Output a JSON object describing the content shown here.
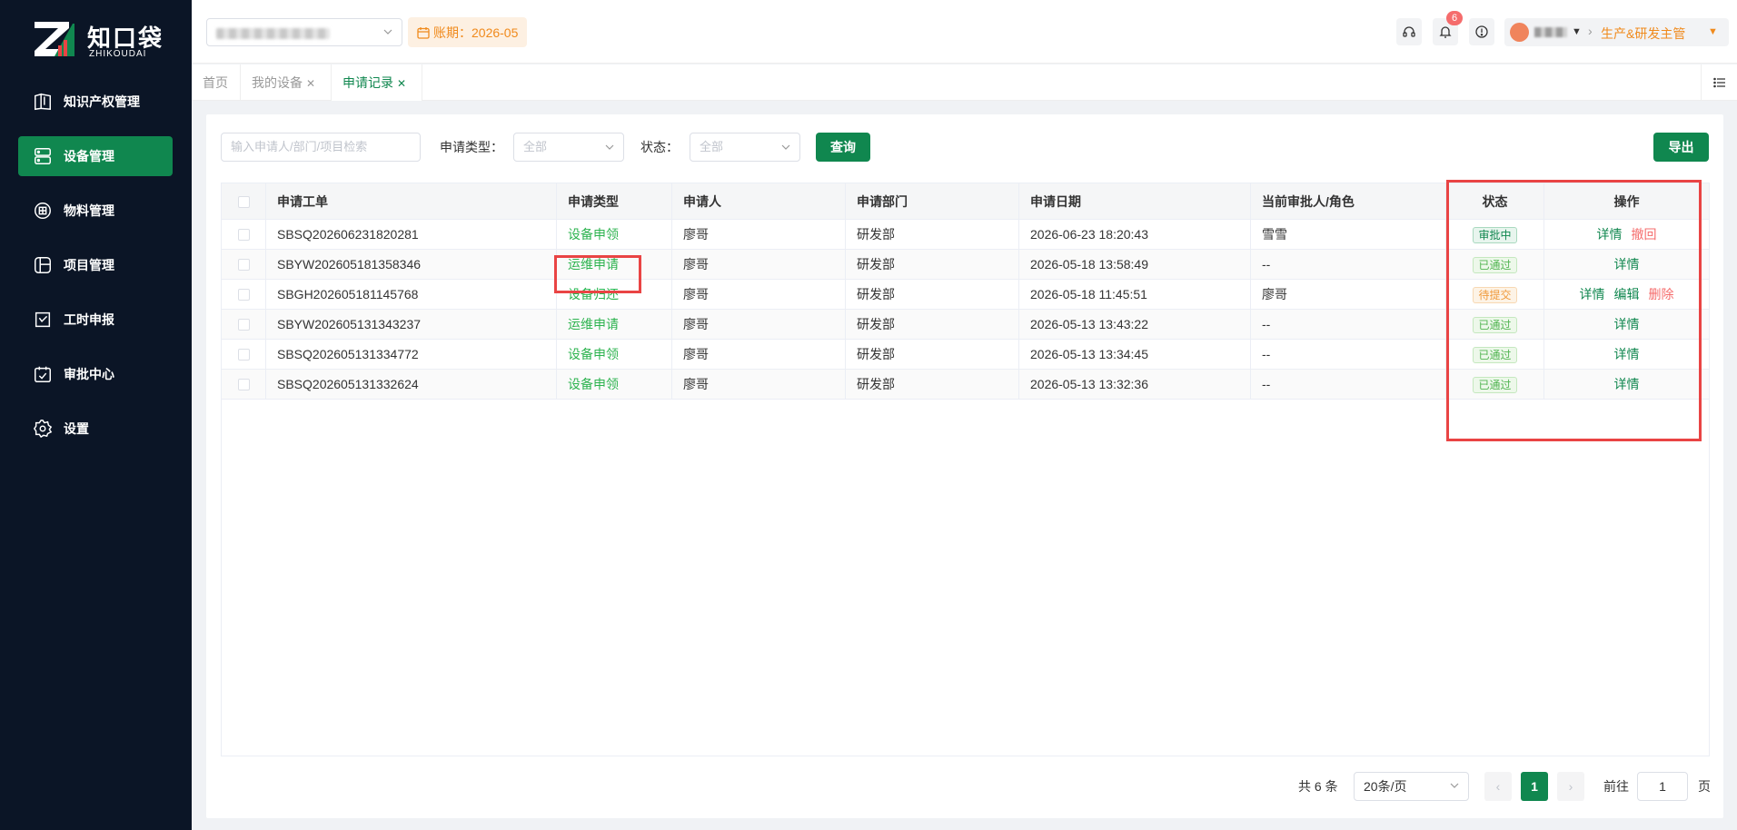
{
  "brand": {
    "name_cn": "知口袋",
    "name_en": "ZHIKOUDAI"
  },
  "sidebar": {
    "items": [
      {
        "label": "知识产权管理",
        "icon": "book-icon",
        "active": false
      },
      {
        "label": "设备管理",
        "icon": "server-icon",
        "active": true
      },
      {
        "label": "物料管理",
        "icon": "box-icon",
        "active": false
      },
      {
        "label": "项目管理",
        "icon": "project-icon",
        "active": false
      },
      {
        "label": "工时申报",
        "icon": "clock-icon",
        "active": false
      },
      {
        "label": "审批中心",
        "icon": "approval-icon",
        "active": false
      },
      {
        "label": "设置",
        "icon": "gear-icon",
        "active": false
      }
    ]
  },
  "header": {
    "period_label": "账期：2026-05",
    "notification_count": "6",
    "role": "生产&研发主管"
  },
  "tabs": [
    {
      "label": "首页",
      "closable": false
    },
    {
      "label": "我的设备",
      "closable": true
    },
    {
      "label": "申请记录",
      "closable": true
    }
  ],
  "filters": {
    "search_placeholder": "输入申请人/部门/项目检索",
    "type_label": "申请类型：",
    "type_value": "全部",
    "status_label": "状态：",
    "status_value": "全部",
    "query_button": "查询",
    "export_button": "导出"
  },
  "table": {
    "columns": [
      "申请工单",
      "申请类型",
      "申请人",
      "申请部门",
      "申请日期",
      "当前审批人/角色",
      "状态",
      "操作"
    ],
    "rows": [
      {
        "order": "SBSQ202606231820281",
        "type": "设备申领",
        "applicant": "廖哥",
        "dept": "研发部",
        "date": "2026-06-23 18:20:43",
        "approver": "雪雪",
        "status": "审批中",
        "status_kind": "pending",
        "ops": [
          {
            "label": "详情",
            "kind": "green"
          },
          {
            "label": "撤回",
            "kind": "red"
          }
        ]
      },
      {
        "order": "SBYW202605181358346",
        "type": "运维申请",
        "applicant": "廖哥",
        "dept": "研发部",
        "date": "2026-05-18 13:58:49",
        "approver": "--",
        "status": "已通过",
        "status_kind": "passed",
        "ops": [
          {
            "label": "详情",
            "kind": "green"
          }
        ]
      },
      {
        "order": "SBGH202605181145768",
        "type": "设备归还",
        "applicant": "廖哥",
        "dept": "研发部",
        "date": "2026-05-18 11:45:51",
        "approver": "廖哥",
        "status": "待提交",
        "status_kind": "draft",
        "ops": [
          {
            "label": "详情",
            "kind": "green"
          },
          {
            "label": "编辑",
            "kind": "green"
          },
          {
            "label": "删除",
            "kind": "red"
          }
        ]
      },
      {
        "order": "SBYW202605131343237",
        "type": "运维申请",
        "applicant": "廖哥",
        "dept": "研发部",
        "date": "2026-05-13 13:43:22",
        "approver": "--",
        "status": "已通过",
        "status_kind": "passed",
        "ops": [
          {
            "label": "详情",
            "kind": "green"
          }
        ]
      },
      {
        "order": "SBSQ202605131334772",
        "type": "设备申领",
        "applicant": "廖哥",
        "dept": "研发部",
        "date": "2026-05-13 13:34:45",
        "approver": "--",
        "status": "已通过",
        "status_kind": "passed",
        "ops": [
          {
            "label": "详情",
            "kind": "green"
          }
        ]
      },
      {
        "order": "SBSQ202605131332624",
        "type": "设备申领",
        "applicant": "廖哥",
        "dept": "研发部",
        "date": "2026-05-13 13:32:36",
        "approver": "--",
        "status": "已通过",
        "status_kind": "passed",
        "ops": [
          {
            "label": "详情",
            "kind": "green"
          }
        ]
      }
    ]
  },
  "pagination": {
    "total": "共 6 条",
    "page_size": "20条/页",
    "current_page": "1",
    "goto_label": "前往",
    "goto_value": "1",
    "page_suffix": "页"
  },
  "colors": {
    "primary": "#10874f",
    "sidebar_bg": "#0b1526",
    "danger": "#f56c6c",
    "warning": "#f08a1c",
    "highlight_box": "#e94444"
  }
}
